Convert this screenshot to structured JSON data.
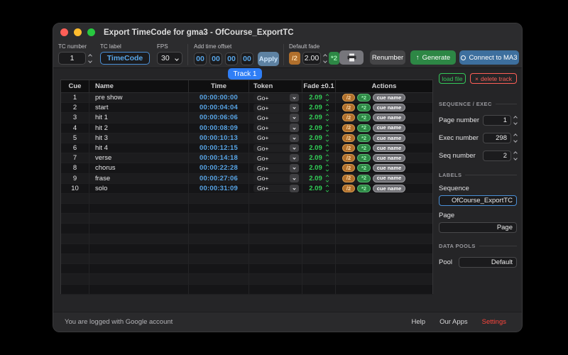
{
  "window": {
    "title": "Export TimeCode for gma3 - OfCourse_ExportTC"
  },
  "toolbar": {
    "tc_number": {
      "label": "TC number",
      "value": "1"
    },
    "tc_label": {
      "label": "TC label",
      "value": "TimeCode"
    },
    "fps": {
      "label": "FPS",
      "value": "30"
    },
    "offset": {
      "label": "Add time offset",
      "values": [
        "00",
        "00",
        "00",
        "00"
      ],
      "apply_label": "Apply"
    },
    "fade": {
      "label": "Default fade",
      "half_label": "/2",
      "value": "2.00",
      "double_label": "*2"
    },
    "renumber_label": "Renumber",
    "generate_label": "Generate",
    "generate_icon": "↑",
    "connect_label": "Connect to MA3"
  },
  "track_tab": {
    "label": "Track 1"
  },
  "table": {
    "headers": [
      "Cue",
      "Name",
      "Time",
      "Token",
      "Fade ±0.1",
      "Actions"
    ],
    "rows": [
      {
        "cue": "1",
        "name": "pre show",
        "time": "00:00:00:00",
        "token": "Go+",
        "fade": "2.09"
      },
      {
        "cue": "2",
        "name": "start",
        "time": "00:00:04:04",
        "token": "Go+",
        "fade": "2.09"
      },
      {
        "cue": "3",
        "name": "hit 1",
        "time": "00:00:06:06",
        "token": "Go+",
        "fade": "2.09"
      },
      {
        "cue": "4",
        "name": "hit 2",
        "time": "00:00:08:09",
        "token": "Go+",
        "fade": "2.09"
      },
      {
        "cue": "5",
        "name": "hit 3",
        "time": "00:00:10:13",
        "token": "Go+",
        "fade": "2.09"
      },
      {
        "cue": "6",
        "name": "hit 4",
        "time": "00:00:12:15",
        "token": "Go+",
        "fade": "2.09"
      },
      {
        "cue": "7",
        "name": "verse",
        "time": "00:00:14:18",
        "token": "Go+",
        "fade": "2.09"
      },
      {
        "cue": "8",
        "name": "chorus",
        "time": "00:00:22:28",
        "token": "Go+",
        "fade": "2.09"
      },
      {
        "cue": "9",
        "name": "frase",
        "time": "00:00:27:06",
        "token": "Go+",
        "fade": "2.09"
      },
      {
        "cue": "10",
        "name": "solo",
        "time": "00:00:31:09",
        "token": "Go+",
        "fade": "2.09"
      }
    ],
    "row_actions": {
      "half_label": "/2",
      "double_label": "*2",
      "cue_name_label": "cue name"
    },
    "empty_row_count": 10
  },
  "sidebar": {
    "load_file_label": "load file",
    "delete_track_icon": "×",
    "delete_track_label": "delete track",
    "sequence_exec": {
      "title": "SEQUENCE / EXEC",
      "fields": [
        {
          "label": "Page number",
          "value": "1"
        },
        {
          "label": "Exec number",
          "value": "298"
        },
        {
          "label": "Seq number",
          "value": "2"
        }
      ]
    },
    "labels_section": {
      "title": "LABELS",
      "sequence_label": "Sequence",
      "sequence_value": "OfCourse_ExportTC",
      "page_label": "Page",
      "page_value": "Page"
    },
    "data_pools": {
      "title": "DATA POOLS",
      "pool_label": "Pool",
      "pool_value": "Default"
    }
  },
  "statusbar": {
    "message": "You are logged with Google account",
    "links": [
      {
        "label": "Help"
      },
      {
        "label": "Our Apps"
      },
      {
        "label": "Settings"
      }
    ]
  },
  "colors": {
    "accent_blue": "#2f7ef6",
    "time_blue": "#58a6e8",
    "fade_green": "#32d158",
    "orange": "#b06f2c",
    "button_green": "#2d8745",
    "connect_blue": "#3d6f9e",
    "apply_blue": "#5e82a2",
    "load_green": "#34c759",
    "danger_red": "#ff5f57",
    "settings_red": "#fb453c"
  }
}
